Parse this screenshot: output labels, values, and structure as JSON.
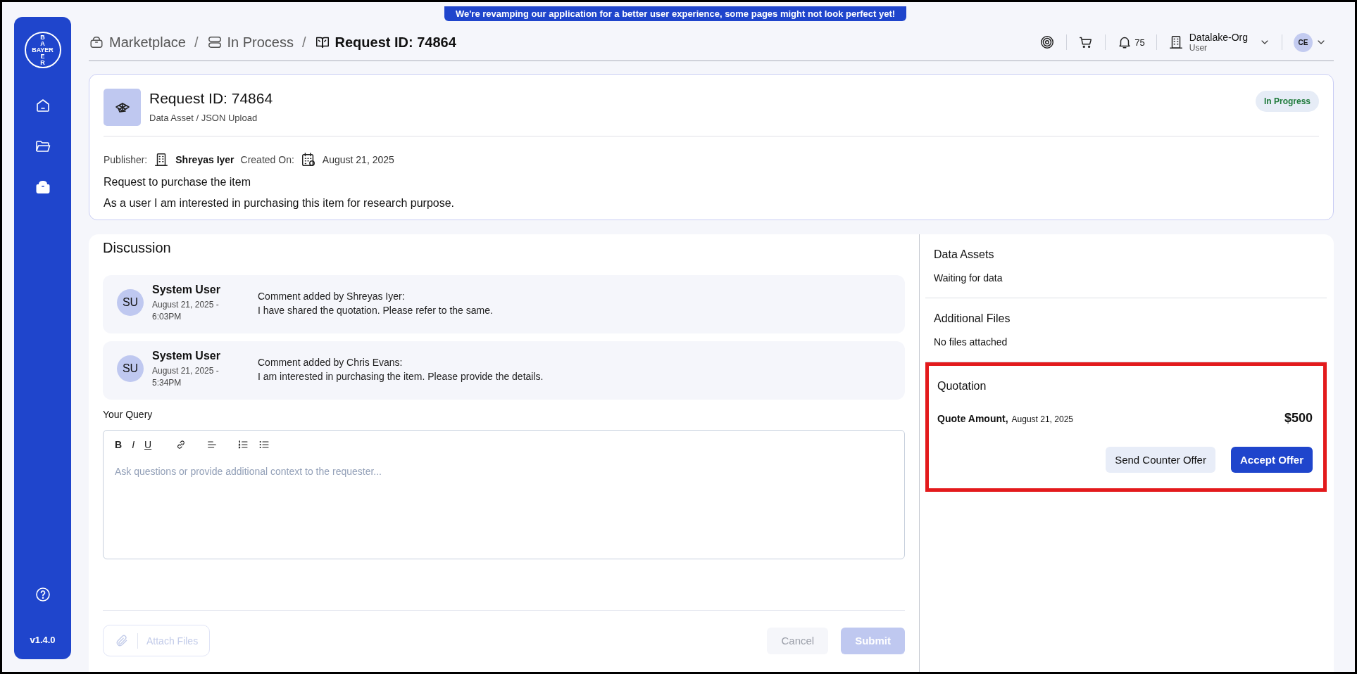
{
  "banner": "We're revamping our application for a better user experience, some pages might not look perfect yet!",
  "sidebar": {
    "logo": {
      "top": "BA",
      "middle": "BAYER",
      "bottom": "ER"
    },
    "items": [
      {
        "kind": "home",
        "selected": false
      },
      {
        "kind": "folder",
        "selected": false
      },
      {
        "kind": "bag",
        "selected": true
      }
    ],
    "version": "v1.4.0"
  },
  "breadcrumb": {
    "separator": "/",
    "items": [
      {
        "label": "Marketplace",
        "kind": "bag",
        "current": false
      },
      {
        "label": "In Process",
        "kind": "stack",
        "current": false
      },
      {
        "label": "Request ID: 74864",
        "kind": "book",
        "current": true
      }
    ]
  },
  "header": {
    "notifications": "75",
    "org": "Datalake-Org",
    "role": "User",
    "avatar": "CE"
  },
  "request": {
    "title": "Request ID: 74864",
    "subtitle": "Data Asset / JSON Upload",
    "status": "In Progress",
    "publisher_label": "Publisher:",
    "publisher": "Shreyas Iyer",
    "created_label": "Created On:",
    "created": "August 21, 2025",
    "heading": "Request to purchase the item",
    "description": "As a user I am interested in purchasing this item for research purpose."
  },
  "discussion": {
    "title": "Discussion",
    "comments": [
      {
        "initials": "SU",
        "author": "System User",
        "date": "August 21, 2025 - 6:03PM",
        "heading": "Comment added by Shreyas Iyer:",
        "body": "I have shared the quotation. Please refer to the same."
      },
      {
        "initials": "SU",
        "author": "System User",
        "date": "August 21, 2025 - 5:34PM",
        "heading": "Comment added by Chris Evans:",
        "body": "I am interested in purchasing the item. Please provide the details."
      }
    ],
    "query_label": "Your Query",
    "toolbar": [
      {
        "kind": "bold",
        "label": "B"
      },
      {
        "kind": "italic",
        "label": "I"
      },
      {
        "kind": "underline",
        "label": "U"
      },
      {
        "kind": "link"
      },
      {
        "kind": "align"
      },
      {
        "kind": "ordered"
      },
      {
        "kind": "bullets"
      }
    ],
    "placeholder": "Ask questions or provide additional context to the requester...",
    "attach": {
      "label": "Attach Files",
      "disabled": true
    },
    "cancel": {
      "label": "Cancel",
      "disabled": true
    },
    "submit": {
      "label": "Submit",
      "disabled": true
    }
  },
  "side": {
    "data_assets": {
      "title": "Data Assets",
      "text": "Waiting for data"
    },
    "additional_files": {
      "title": "Additional Files",
      "text": "No files attached"
    },
    "quotation": {
      "title": "Quotation",
      "label": "Quote Amount,",
      "date": "August 21, 2025",
      "amount": "$500",
      "counter": "Send Counter Offer",
      "accept": "Accept Offer",
      "highlighted": true
    }
  }
}
